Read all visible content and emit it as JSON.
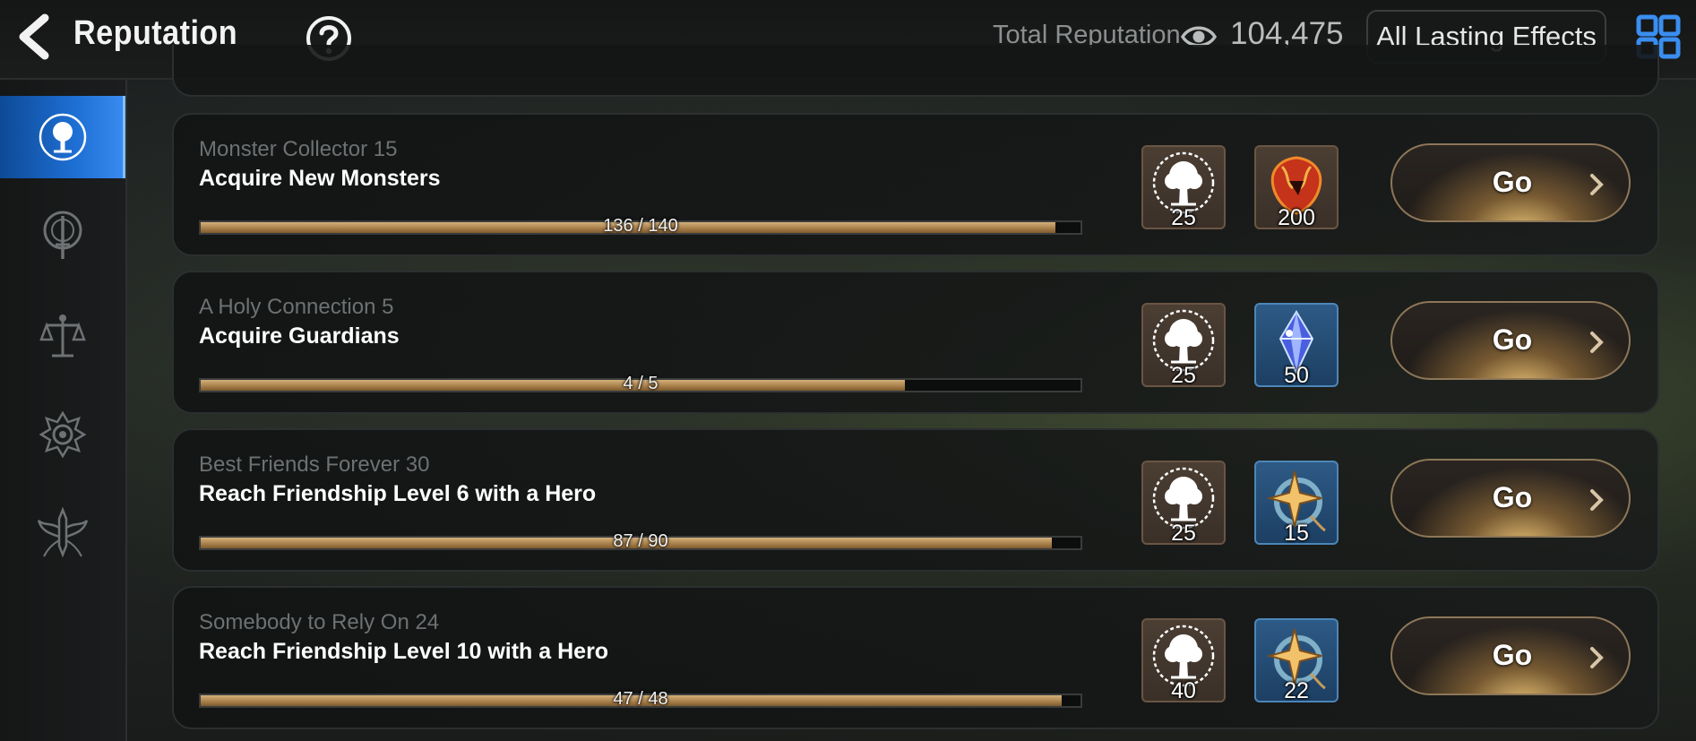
{
  "header": {
    "title": "Reputation",
    "total_label": "Total Reputation",
    "total_value": "104,475",
    "lasting_effects_label": "All Lasting Effects"
  },
  "sidebar": {
    "items": [
      {
        "icon": "tree-emblem-icon",
        "active": true
      },
      {
        "icon": "sword-medallion-icon",
        "active": false
      },
      {
        "icon": "scales-icon",
        "active": false
      },
      {
        "icon": "swirl-emblem-icon",
        "active": false
      },
      {
        "icon": "winged-blade-icon",
        "active": false
      }
    ]
  },
  "quests": [
    {
      "subtitle": "Monster Collector 15",
      "description": "Acquire New Monsters",
      "progress_text": "136 / 140",
      "progress": 0.971,
      "rewards": [
        {
          "icon": "reputation-tree-icon",
          "amount": "25",
          "frame": "brown"
        },
        {
          "icon": "red-crest-icon",
          "amount": "200",
          "frame": "brown"
        }
      ],
      "button": "Go"
    },
    {
      "subtitle": "A Holy Connection 5",
      "description": "Acquire Guardians",
      "progress_text": "4 / 5",
      "progress": 0.8,
      "rewards": [
        {
          "icon": "reputation-tree-icon",
          "amount": "25",
          "frame": "brown"
        },
        {
          "icon": "blue-crystal-icon",
          "amount": "50",
          "frame": "blue"
        }
      ],
      "button": "Go"
    },
    {
      "subtitle": "Best Friends Forever 30",
      "description": "Reach Friendship Level 6 with a Hero",
      "progress_text": "87 / 90",
      "progress": 0.967,
      "rewards": [
        {
          "icon": "reputation-tree-icon",
          "amount": "25",
          "frame": "brown"
        },
        {
          "icon": "star-compass-icon",
          "amount": "15",
          "frame": "blue"
        }
      ],
      "button": "Go"
    },
    {
      "subtitle": "Somebody to Rely On 24",
      "description": "Reach Friendship Level 10 with a Hero",
      "progress_text": "47 / 48",
      "progress": 0.979,
      "rewards": [
        {
          "icon": "reputation-tree-icon",
          "amount": "40",
          "frame": "brown"
        },
        {
          "icon": "star-compass-icon",
          "amount": "22",
          "frame": "blue"
        }
      ],
      "button": "Go"
    }
  ],
  "colors": {
    "accent_blue": "#1e6fd4",
    "progress_fill": "#a57d48",
    "go_glow": "#f0c878"
  }
}
